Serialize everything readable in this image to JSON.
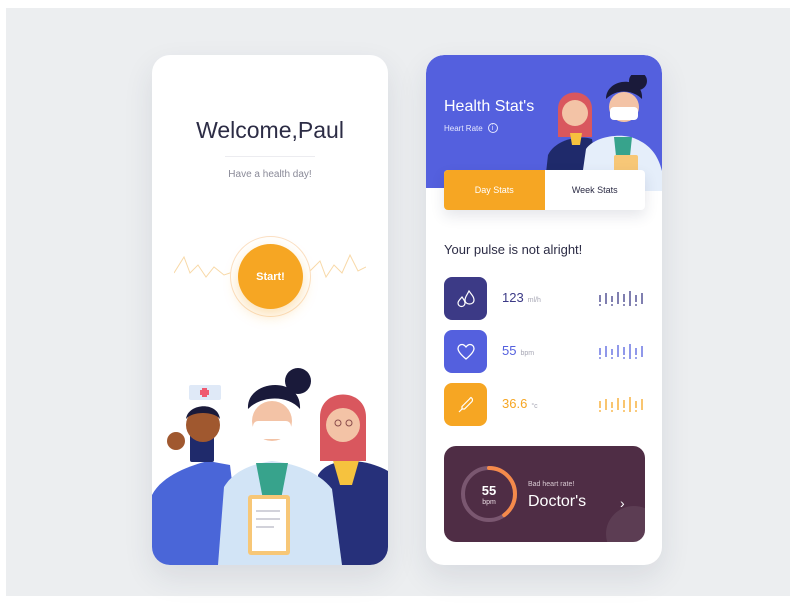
{
  "welcome": {
    "title": "Welcome,Paul",
    "subtitle": "Have a health day!",
    "start_label": "Start!"
  },
  "stats": {
    "title": "Health Stat's",
    "subtitle": "Heart Rate",
    "info_glyph": "i",
    "tabs": [
      {
        "label": "Day Stats",
        "active": true
      },
      {
        "label": "Week Stats",
        "active": false
      }
    ],
    "pulse_message": "Your pulse is not alright!",
    "rows": [
      {
        "icon": "drops-icon",
        "value": "123",
        "unit": "ml/h",
        "color": "#3c3a86"
      },
      {
        "icon": "heart-icon",
        "value": "55",
        "unit": "bpm",
        "color": "#5460de"
      },
      {
        "icon": "thermometer-icon",
        "value": "36.6",
        "unit": "°c",
        "color": "#f6a623"
      }
    ],
    "card": {
      "gauge_value": "55",
      "gauge_unit": "bpm",
      "gauge_level": 0.4,
      "subtitle": "Bad heart rate!",
      "title": "Doctor's",
      "chevron": "›"
    }
  },
  "colors": {
    "accent_orange": "#f6a623",
    "accent_blue": "#5460de",
    "accent_dark_blue": "#3c3a86",
    "card_plum": "#4f2d45",
    "background": "#eceef0"
  }
}
